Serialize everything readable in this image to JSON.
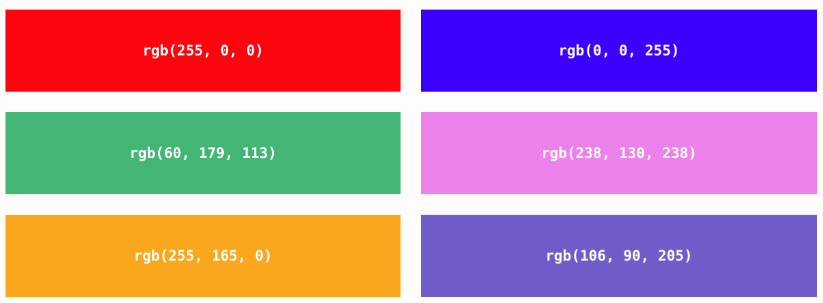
{
  "swatches": [
    {
      "label": "rgb(255, 0, 0)",
      "color": "#fe040e"
    },
    {
      "label": "rgb(0, 0, 255)",
      "color": "#3b00fe"
    },
    {
      "label": "rgb(60, 179, 113)",
      "color": "#43b575"
    },
    {
      "label": "rgb(238, 130, 238)",
      "color": "#ed81ec"
    },
    {
      "label": "rgb(255, 165, 0)",
      "color": "#faa71d"
    },
    {
      "label": "rgb(106, 90, 205)",
      "color": "#705bc8"
    }
  ]
}
